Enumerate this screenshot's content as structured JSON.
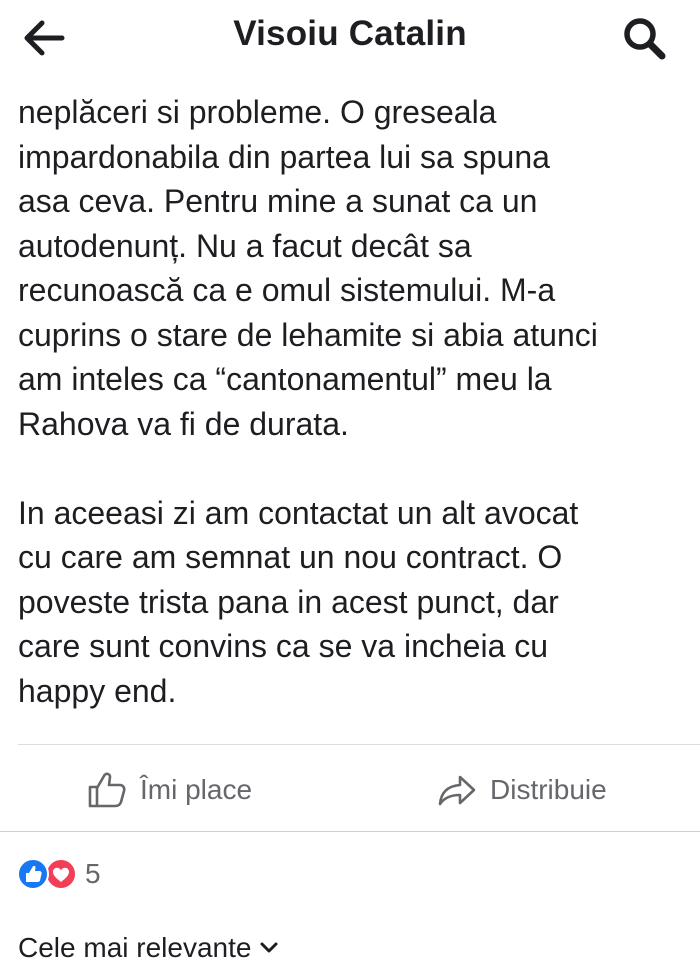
{
  "header": {
    "title": "Visoiu Catalin",
    "back_icon": "back-arrow-icon",
    "search_icon": "search-icon"
  },
  "post": {
    "paragraph_1": "neplăceri si probleme. O greseala impardonabila din partea lui sa spuna asa ceva. Pentru mine a sunat ca un autodenunț. Nu a facut decât sa recunoască ca e omul sistemului. M-a cuprins o stare de lehamite si abia atunci am inteles ca “cantonamentul” meu la Rahova va fi de durata.",
    "paragraph_2": "In aceeasi zi am contactat un alt avocat cu care am semnat un nou contract. O poveste trista pana in acest punct, dar care sunt convins ca se va incheia cu happy end.",
    "lines_1": [
      "neplăceri si probleme. O greseala",
      "impardonabila din partea lui sa spuna",
      "asa ceva. Pentru mine a sunat ca un",
      "autodenunț. Nu a facut decât sa",
      "recunoască ca e omul sistemului. M-a",
      "cuprins o stare de lehamite si abia atunci",
      "am inteles ca “cantonamentul” meu la",
      "Rahova va fi de durata."
    ],
    "lines_2": [
      "In aceeasi zi am contactat un alt avocat",
      "cu care am semnat un nou contract. O",
      "poveste trista pana in acest punct, dar",
      "care sunt convins ca se va incheia cu",
      "happy end."
    ]
  },
  "actions": {
    "like_label": "Îmi place",
    "like_icon": "thumbs-up-icon",
    "share_label": "Distribuie",
    "share_icon": "share-arrow-icon"
  },
  "reactions": {
    "count": "5",
    "icons": [
      "like-reaction-icon",
      "love-reaction-icon"
    ],
    "colors": {
      "like": "#1877f2",
      "love": "#f33e58"
    }
  },
  "comments": {
    "sort_label": "Cele mai relevante",
    "sort_icon": "chevron-down-icon"
  }
}
